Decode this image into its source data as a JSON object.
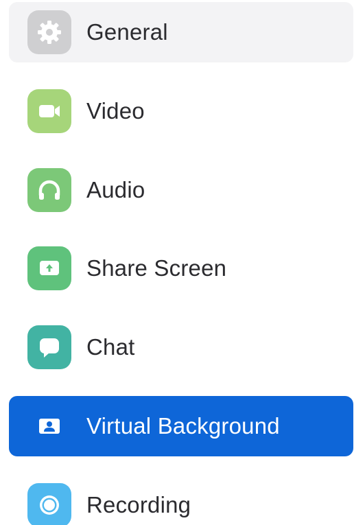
{
  "sidebar": {
    "items": [
      {
        "label": "General",
        "icon": "gear-icon",
        "icon_color": "#cfcfd1",
        "selected": false
      },
      {
        "label": "Video",
        "icon": "video-camera-icon",
        "icon_color": "#a6d57a",
        "selected": false
      },
      {
        "label": "Audio",
        "icon": "headphones-icon",
        "icon_color": "#7cc878",
        "selected": false
      },
      {
        "label": "Share Screen",
        "icon": "share-screen-icon",
        "icon_color": "#5fc27c",
        "selected": false
      },
      {
        "label": "Chat",
        "icon": "chat-bubble-icon",
        "icon_color": "#42b3a3",
        "selected": false
      },
      {
        "label": "Virtual Background",
        "icon": "virtual-background-icon",
        "icon_color": "#ffffff",
        "selected": true
      },
      {
        "label": "Recording",
        "icon": "record-icon",
        "icon_color": "#4fb8ef",
        "selected": false
      }
    ],
    "selected_background": "#0e66d8",
    "hover_background": "#f3f3f5"
  }
}
